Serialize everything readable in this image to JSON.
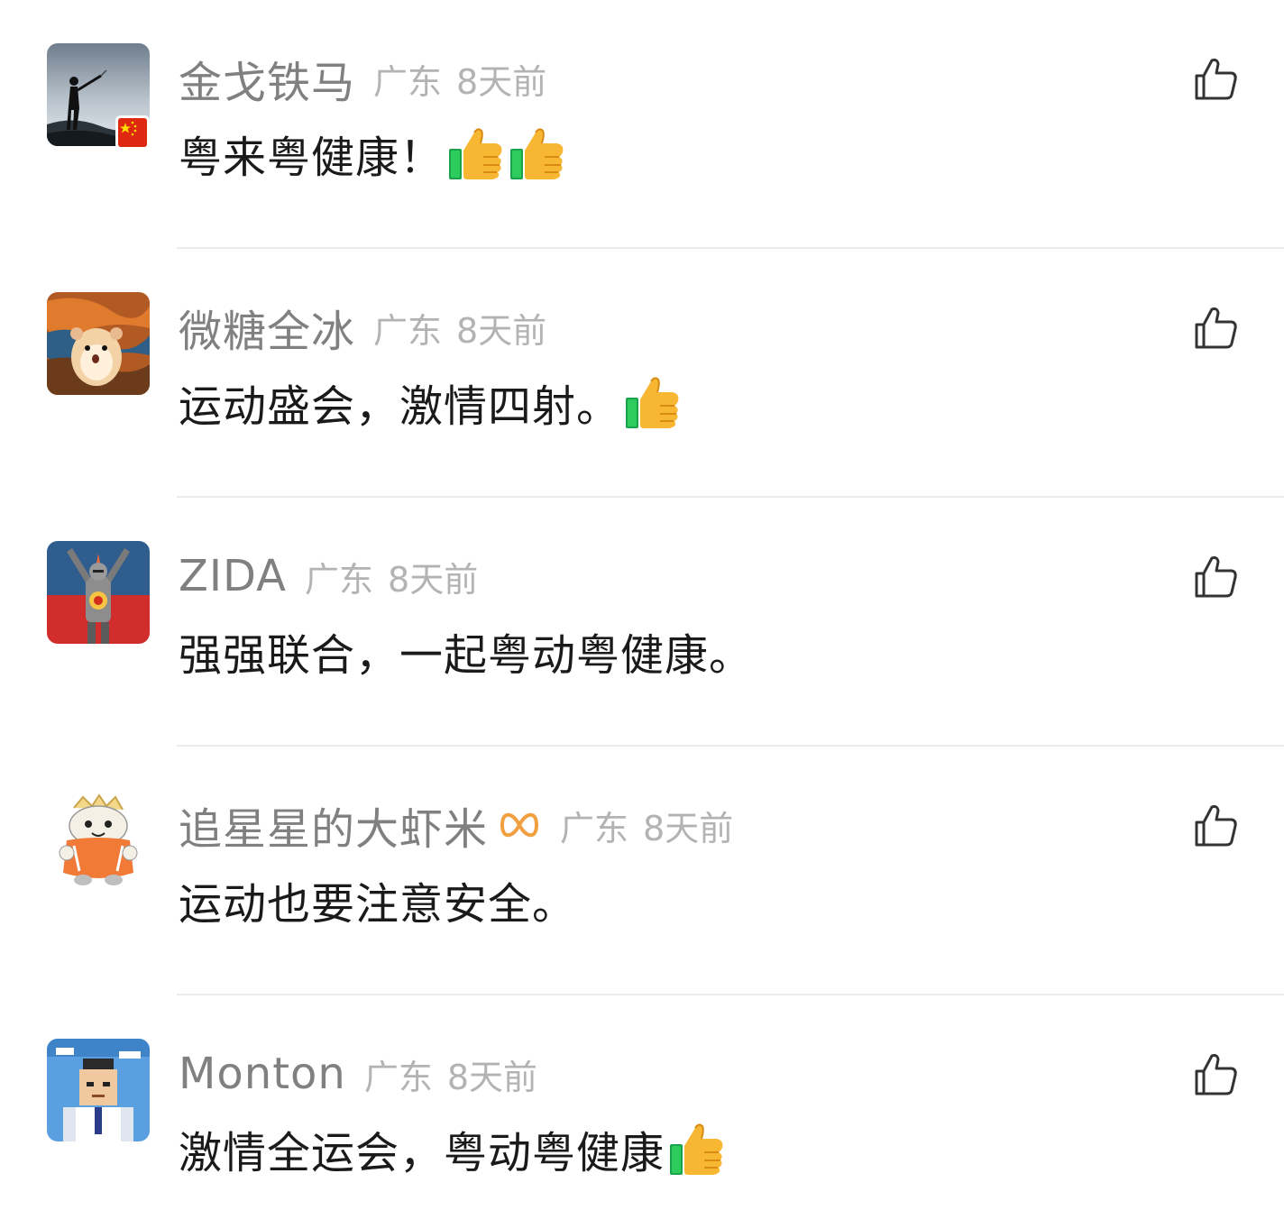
{
  "comments": [
    {
      "username": "金戈铁马",
      "location": "广东",
      "time": "8天前",
      "text": "粤来粤健康！",
      "emoji": [
        "thumbs-up",
        "thumbs-up"
      ],
      "avatar_icon": "silhouette-on-mountain-avatar",
      "badge_icon": "china-flag-icon"
    },
    {
      "username": "微糖全冰",
      "location": "广东",
      "time": "8天前",
      "text": "运动盛会，激情四射。",
      "emoji": [
        "thumbs-up"
      ],
      "avatar_icon": "hamster-scream-painting-avatar"
    },
    {
      "username": "ZIDA",
      "location": "广东",
      "time": "8天前",
      "text": "强强联合，一起粤动粤健康。",
      "emoji": [],
      "avatar_icon": "knight-praise-sun-avatar"
    },
    {
      "username": "追星星的大虾米",
      "location": "广东",
      "time": "8天前",
      "text": "运动也要注意安全。",
      "emoji": [],
      "avatar_icon": "cartoon-tiger-avatar",
      "vip_icon": "infinity-vip-icon"
    },
    {
      "username": "Monton",
      "location": "广东",
      "time": "8天前",
      "text": "激情全运会，粤动粤健康",
      "emoji": [
        "thumbs-up"
      ],
      "avatar_icon": "pixel-man-avatar"
    }
  ],
  "colors": {
    "username": "#808080",
    "meta": "#b3b3b3",
    "text": "#1a1a1a",
    "divider": "#ececec",
    "vip_accent": "#f0a040"
  },
  "icons": {
    "like": "thumbs-up-outline-icon"
  }
}
